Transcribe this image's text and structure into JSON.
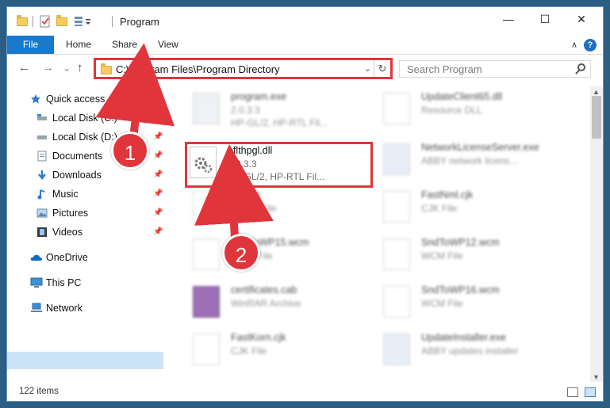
{
  "window": {
    "title": "Program"
  },
  "window_controls": {
    "minimize": "—",
    "maximize": "☐",
    "close": "✕"
  },
  "ribbon": {
    "tabs": [
      "File",
      "Home",
      "Share",
      "View"
    ],
    "help": "?",
    "collapse": "∧"
  },
  "navigation": {
    "back": "←",
    "forward": "→",
    "recent": "⌄",
    "up": "↑"
  },
  "address": {
    "path": "C:\\Program Files\\Program Directory",
    "dropdown": "⌄",
    "refresh": "↻"
  },
  "search": {
    "placeholder": "Search Program"
  },
  "sidebar": {
    "items": [
      {
        "label": "Quick access",
        "icon": "star-icon",
        "pinned": false
      },
      {
        "label": "Local Disk (C:)",
        "icon": "drive-icon",
        "pinned": true
      },
      {
        "label": "Local Disk (D:)",
        "icon": "drive-icon",
        "pinned": true
      },
      {
        "label": "Documents",
        "icon": "documents-icon",
        "pinned": true
      },
      {
        "label": "Downloads",
        "icon": "downloads-icon",
        "pinned": true
      },
      {
        "label": "Music",
        "icon": "music-icon",
        "pinned": true
      },
      {
        "label": "Pictures",
        "icon": "pictures-icon",
        "pinned": true
      },
      {
        "label": "Videos",
        "icon": "videos-icon",
        "pinned": true
      },
      {
        "label": "OneDrive",
        "icon": "cloud-icon",
        "pinned": false
      },
      {
        "label": "This PC",
        "icon": "computer-icon",
        "pinned": false,
        "selected": true
      },
      {
        "label": "Network",
        "icon": "network-icon",
        "pinned": false
      }
    ],
    "pin_glyph": "📌"
  },
  "files": [
    {
      "name": "program.exe",
      "line2": "2.0.3.3",
      "line3": "HP-GL/2, HP-RTL Fil...",
      "blurred": true
    },
    {
      "name": "UpdateClient65.dll",
      "line2": "Resource DLL",
      "line3": "",
      "blurred": true
    },
    {
      "name": "pflthpgl.dll",
      "line2": "2.0.3.3",
      "line3": "HP-GL/2, HP-RTL Fil...",
      "blurred": false
    },
    {
      "name": "NetworkLicenseServer.exe",
      "line2": "ABBY network licens...",
      "line3": "",
      "blurred": true
    },
    {
      "name": "...cjk",
      "line2": "CJK File",
      "line3": "",
      "blurred": true
    },
    {
      "name": "FastNml.cjk",
      "line2": "CJK File",
      "line3": "",
      "blurred": true
    },
    {
      "name": "SndToWP15.wcm",
      "line2": "WCM File",
      "line3": "",
      "blurred": true
    },
    {
      "name": "SndToWP12.wcm",
      "line2": "WCM File",
      "line3": "",
      "blurred": true
    },
    {
      "name": "certificates.cab",
      "line2": "WinRAR Archive",
      "line3": "",
      "blurred": true
    },
    {
      "name": "SndToWP16.wcm",
      "line2": "WCM File",
      "line3": "",
      "blurred": true
    },
    {
      "name": "FastKorn.cjk",
      "line2": "CJK File",
      "line3": "",
      "blurred": true
    },
    {
      "name": "UpdateInstaller.exe",
      "line2": "ABBY updates installer",
      "line3": "",
      "blurred": true
    }
  ],
  "status": {
    "count": "122 items"
  },
  "annotations": {
    "step1": "1",
    "step2": "2"
  },
  "colors": {
    "accent": "#1979ca",
    "highlight": "#e0353b",
    "selection": "#cce4f7"
  }
}
